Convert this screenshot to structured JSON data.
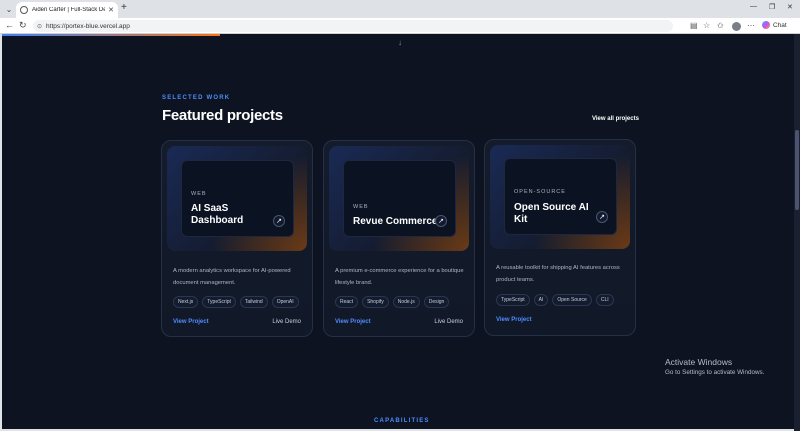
{
  "browser": {
    "tab_title": "Aiden Carter | Full-Stack Developer",
    "url": "https://portex-blue.vercel.app",
    "chat_label": "Chat"
  },
  "section": {
    "eyebrow": "SELECTED WORK",
    "heading": "Featured projects",
    "view_all": "View all projects"
  },
  "projects": [
    {
      "category": "WEB",
      "title": "AI SaaS Dashboard",
      "description": "A modern analytics workspace for AI-powered document management.",
      "tags": [
        "Next.js",
        "TypeScript",
        "Tailwind",
        "OpenAI"
      ],
      "view_label": "View Project",
      "demo_label": "Live Demo"
    },
    {
      "category": "WEB",
      "title": "Revue Commerce",
      "description": "A premium e-commerce experience for a boutique lifestyle brand.",
      "tags": [
        "React",
        "Shopify",
        "Node.js",
        "Design"
      ],
      "view_label": "View Project",
      "demo_label": "Live Demo"
    },
    {
      "category": "OPEN-SOURCE",
      "title": "Open Source AI Kit",
      "description": "A reusable toolkit for shipping AI features across product teams.",
      "tags": [
        "TypeScript",
        "AI",
        "Open Source",
        "CLI"
      ],
      "view_label": "View Project",
      "demo_label": ""
    }
  ],
  "next_section": {
    "eyebrow": "CAPABILITIES"
  },
  "windows_notice": {
    "title": "Activate Windows",
    "subtitle": "Go to Settings to activate Windows."
  },
  "colors": {
    "background": "#0d1320",
    "accent": "#4f8cff",
    "card": "#111827"
  }
}
